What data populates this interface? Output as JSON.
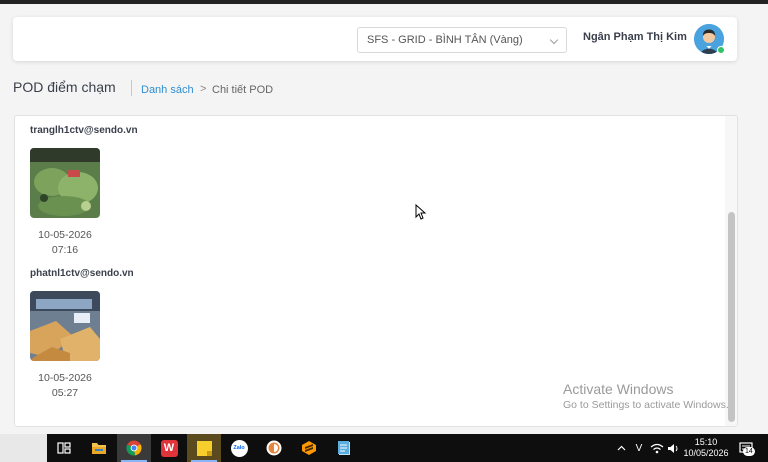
{
  "header": {
    "store_select_value": "SFS - GRID - BÌNH TÂN (Vàng)",
    "user_name": "Ngân Phạm Thị Kim"
  },
  "page": {
    "title": "POD điểm chạm",
    "breadcrumb_link": "Danh sách",
    "breadcrumb_sep": ">",
    "breadcrumb_current": "Chi tiết POD"
  },
  "pods": [
    {
      "email": "tranglh1ctv@sendo.vn",
      "date": "10-05-2026",
      "time": "07:16"
    },
    {
      "email": "phatnl1ctv@sendo.vn",
      "date": "10-05-2026",
      "time": "05:27"
    }
  ],
  "watermark": {
    "line1": "Activate Windows",
    "line2": "Go to Settings to activate Windows."
  },
  "taskbar": {
    "apps": [
      "task-view-icon",
      "file-explorer-icon",
      "chrome-icon",
      "wps-office-icon",
      "sticky-notes-icon",
      "zalo-icon",
      "app-icon",
      "sublime-text-icon",
      "notepad-icon"
    ],
    "zalo_label": "Zalo",
    "wps_label": "W",
    "time": "15:10",
    "date": "10/05/2026",
    "notification_count": "14",
    "input_lang": "V"
  },
  "colors": {
    "link": "#2f8fd0",
    "avatar_bg": "#4aa3df",
    "online": "#35c06a"
  }
}
